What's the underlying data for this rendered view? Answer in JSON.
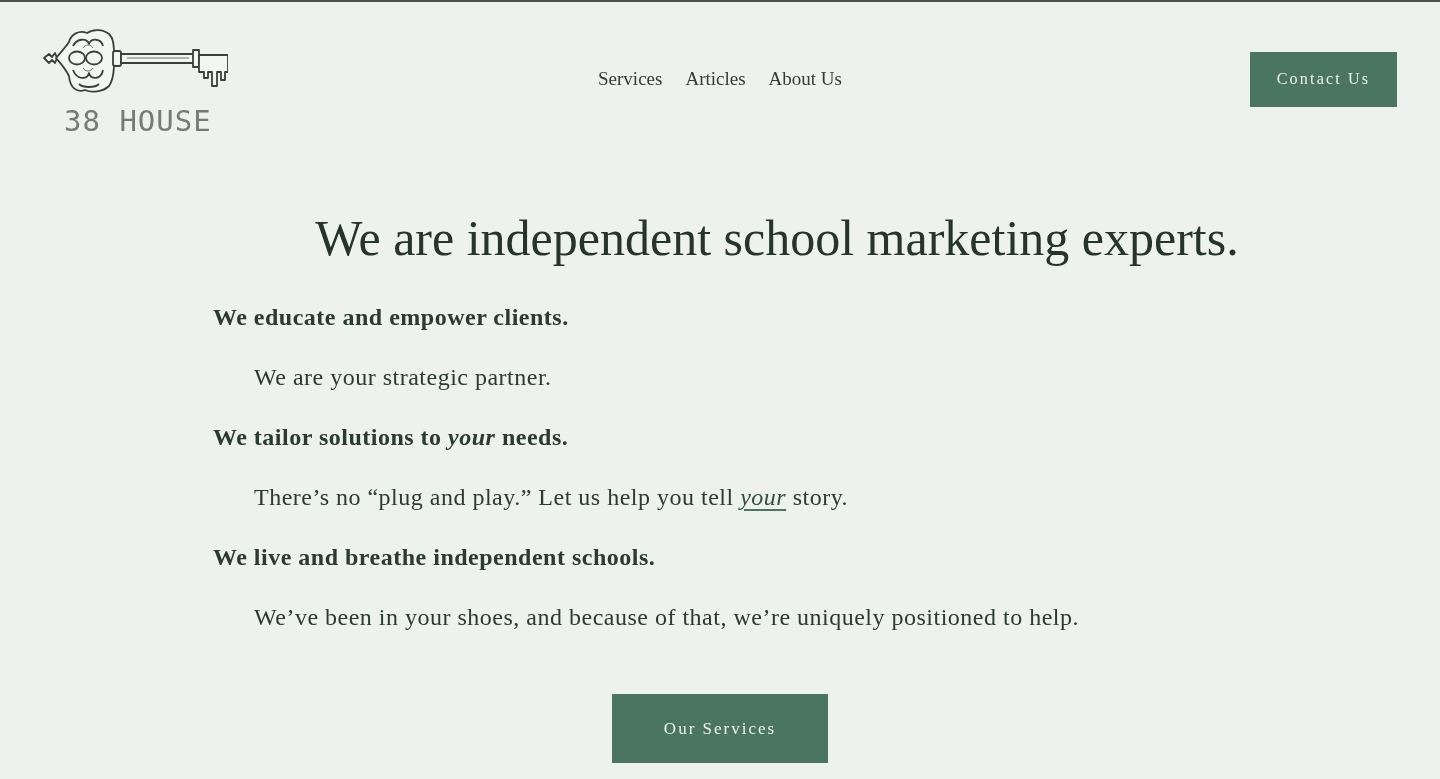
{
  "header": {
    "logo": {
      "text": "38 HOUSE"
    },
    "nav": [
      {
        "label": "Services"
      },
      {
        "label": "Articles"
      },
      {
        "label": "About Us"
      }
    ],
    "cta": {
      "label": "Contact Us"
    }
  },
  "hero": {
    "headline": "We are independent school marketing experts.",
    "points": [
      {
        "kind": "statement",
        "parts": [
          {
            "kind": "text",
            "text": "We educate and empower clients."
          }
        ]
      },
      {
        "kind": "detail",
        "parts": [
          {
            "kind": "text",
            "text": "We are your strategic partner."
          }
        ]
      },
      {
        "kind": "statement",
        "parts": [
          {
            "kind": "text",
            "text": "We tailor solutions to *your* needs."
          }
        ]
      },
      {
        "kind": "detail",
        "parts": [
          {
            "kind": "text",
            "text": "There’s no “plug and play.” Let us help you tell "
          },
          {
            "kind": "link",
            "text": "your"
          },
          {
            "kind": "text",
            "text": " story."
          }
        ]
      },
      {
        "kind": "statement",
        "parts": [
          {
            "kind": "text",
            "text": "We live and breathe independent schools."
          }
        ]
      },
      {
        "kind": "detail",
        "parts": [
          {
            "kind": "text",
            "text": "We’ve been in your shoes, and because of that, we’re uniquely positioned to help."
          }
        ]
      }
    ],
    "button": {
      "label": "Our Services"
    }
  }
}
